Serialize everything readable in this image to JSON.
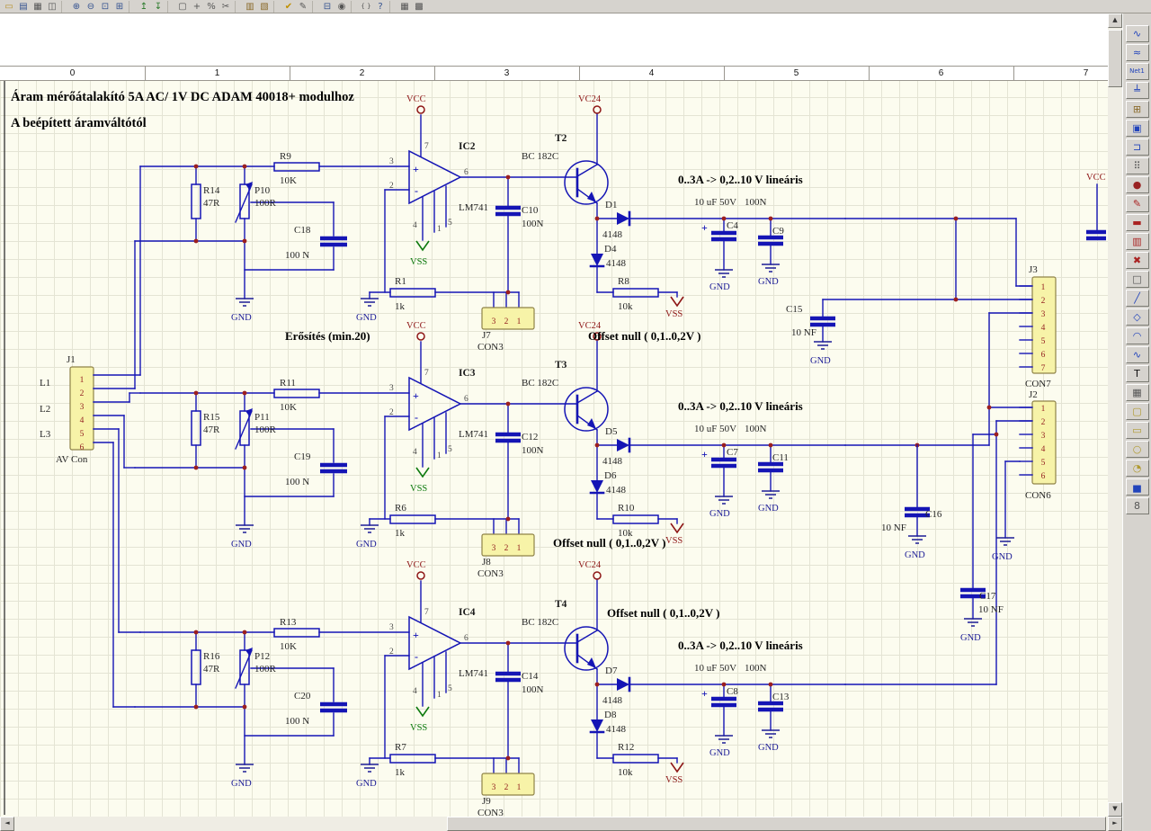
{
  "titles": {
    "line1": "Áram mérőátalakító 5A AC/ 1V DC ADAM 40018+ modulhoz",
    "line2": "A beépített áramváltótól"
  },
  "annotations": {
    "gain": "Erősítés (min.20)"
  },
  "nets": {
    "gnd": "GND",
    "vcc": "VCC",
    "vss": "VSS",
    "vc24": "VC24"
  },
  "pins": {
    "p1": "1",
    "p2": "2",
    "p3": "3",
    "p4": "4",
    "p5": "5",
    "p6": "6",
    "p7": "7"
  },
  "sym": {
    "plus": "+",
    "minus": "-"
  },
  "ruler": {
    "numbers": [
      "0",
      "1",
      "2",
      "3",
      "4",
      "5",
      "6",
      "7"
    ]
  },
  "channels": [
    {
      "opamp": {
        "ref": "IC2",
        "part": "LM741"
      },
      "r_series": {
        "ref": "R9",
        "val": "10K"
      },
      "r_in": {
        "ref": "R14",
        "val": "47R"
      },
      "pot": {
        "ref": "P10",
        "val": "100R"
      },
      "c_fb": {
        "ref": "C18",
        "val": "100 N"
      },
      "c_out": {
        "ref": "C10",
        "val": "100N"
      },
      "transistor": {
        "ref": "T2",
        "part": "BC 182C"
      },
      "d_series": {
        "ref": "D1",
        "val": "4148"
      },
      "d_shunt": {
        "ref": "D4",
        "val": "4148"
      },
      "r_fb": {
        "ref": "R1",
        "val": "1k"
      },
      "r_out": {
        "ref": "R8",
        "val": "10k"
      },
      "cap_el": {
        "ref": "C4",
        "val": "10 uF 50V"
      },
      "cap_cer": {
        "ref": "C9",
        "val": "100N"
      },
      "conn": {
        "ref": "J7",
        "type": "CON3",
        "pins": [
          "3",
          "2",
          "1"
        ]
      },
      "ann_linear": "0..3A -> 0,2..10 V lineáris",
      "ann_offset": "Offset null ( 0,1..0,2V )"
    },
    {
      "opamp": {
        "ref": "IC3",
        "part": "LM741"
      },
      "r_series": {
        "ref": "R11",
        "val": "10K"
      },
      "r_in": {
        "ref": "R15",
        "val": "47R"
      },
      "pot": {
        "ref": "P11",
        "val": "100R"
      },
      "c_fb": {
        "ref": "C19",
        "val": "100 N"
      },
      "c_out": {
        "ref": "C12",
        "val": "100N"
      },
      "transistor": {
        "ref": "T3",
        "part": "BC 182C"
      },
      "d_series": {
        "ref": "D5",
        "val": "4148"
      },
      "d_shunt": {
        "ref": "D6",
        "val": "4148"
      },
      "r_fb": {
        "ref": "R6",
        "val": "1k"
      },
      "r_out": {
        "ref": "R10",
        "val": "10k"
      },
      "cap_el": {
        "ref": "C7",
        "val": "10 uF 50V"
      },
      "cap_cer": {
        "ref": "C11",
        "val": "100N"
      },
      "conn": {
        "ref": "J8",
        "type": "CON3",
        "pins": [
          "3",
          "2",
          "1"
        ]
      },
      "ann_linear": "0..3A -> 0,2..10 V lineáris",
      "ann_offset": "Offset null ( 0,1..0,2V )"
    },
    {
      "opamp": {
        "ref": "IC4",
        "part": "LM741"
      },
      "r_series": {
        "ref": "R13",
        "val": "10K"
      },
      "r_in": {
        "ref": "R16",
        "val": "47R"
      },
      "pot": {
        "ref": "P12",
        "val": "100R"
      },
      "c_fb": {
        "ref": "C20",
        "val": "100 N"
      },
      "c_out": {
        "ref": "C14",
        "val": "100N"
      },
      "transistor": {
        "ref": "T4",
        "part": "BC 182C"
      },
      "d_series": {
        "ref": "D7",
        "val": "4148"
      },
      "d_shunt": {
        "ref": "D8",
        "val": "4148"
      },
      "r_fb": {
        "ref": "R7",
        "val": "1k"
      },
      "r_out": {
        "ref": "R12",
        "val": "10k"
      },
      "cap_el": {
        "ref": "C8",
        "val": "10 uF 50V"
      },
      "cap_cer": {
        "ref": "C13",
        "val": "100N"
      },
      "conn": {
        "ref": "J9",
        "type": "CON3",
        "pins": [
          "3",
          "2",
          "1"
        ]
      },
      "ann_linear": "0..3A -> 0,2..10 V lineáris",
      "ann_offset": "Offset null ( 0,1..0,2V )"
    }
  ],
  "j1": {
    "ref": "J1",
    "type": "AV Con",
    "pins": [
      "1",
      "2",
      "3",
      "4",
      "5",
      "6"
    ],
    "phases": [
      "L1",
      "L2",
      "L3"
    ]
  },
  "j3": {
    "ref": "J3",
    "type": "CON7",
    "pins": [
      "1",
      "2",
      "3",
      "4",
      "5",
      "6",
      "7"
    ]
  },
  "j2": {
    "ref": "J2",
    "type": "CON6",
    "pins": [
      "1",
      "2",
      "3",
      "4",
      "5",
      "6"
    ]
  },
  "filter_caps": [
    {
      "ref": "C15",
      "val": "10 NF"
    },
    {
      "ref": "C16",
      "val": "10 NF"
    },
    {
      "ref": "C17",
      "val": "10 NF"
    }
  ],
  "edge": {
    "vcc": "VCC"
  },
  "toolbar": {
    "icons": [
      {
        "name": "open",
        "glyph": "▭",
        "color": "#b8912a"
      },
      {
        "name": "save",
        "glyph": "▤",
        "color": "#33518f"
      },
      {
        "name": "print",
        "glyph": "▦",
        "color": "#555555"
      },
      {
        "name": "print-preview",
        "glyph": "◫",
        "color": "#555555"
      },
      {
        "name": "separator"
      },
      {
        "name": "zoom-in",
        "glyph": "⊕",
        "color": "#33518f"
      },
      {
        "name": "zoom-out",
        "glyph": "⊖",
        "color": "#33518f"
      },
      {
        "name": "zoom-window",
        "glyph": "⊡",
        "color": "#33518f"
      },
      {
        "name": "zoom-all",
        "glyph": "⊞",
        "color": "#33518f"
      },
      {
        "name": "separator"
      },
      {
        "name": "ascend-hierarchy",
        "glyph": "↥",
        "color": "#2a7a2a"
      },
      {
        "name": "descend-hierarchy",
        "glyph": "↧",
        "color": "#2a7a2a"
      },
      {
        "name": "separator"
      },
      {
        "name": "select-area",
        "glyph": "▢",
        "color": "#555555"
      },
      {
        "name": "move-selection",
        "glyph": "+",
        "color": "#555555"
      },
      {
        "name": "scale",
        "glyph": "%",
        "color": "#555555"
      },
      {
        "name": "cut",
        "glyph": "✂",
        "color": "#555555"
      },
      {
        "name": "separator"
      },
      {
        "name": "library",
        "glyph": "▥",
        "color": "#8a6a2a"
      },
      {
        "name": "browse-library",
        "glyph": "▧",
        "color": "#8a6a2a"
      },
      {
        "name": "separator"
      },
      {
        "name": "erc-check",
        "glyph": "✔",
        "color": "#c09000"
      },
      {
        "name": "edit-sheet",
        "glyph": "✎",
        "color": "#555555"
      },
      {
        "name": "separator"
      },
      {
        "name": "add-part",
        "glyph": "⊟",
        "color": "#33518f"
      },
      {
        "name": "visibility",
        "glyph": "◉",
        "color": "#555555"
      },
      {
        "name": "separator"
      },
      {
        "name": "braces",
        "glyph": "{ }",
        "color": "#555555",
        "small": true
      },
      {
        "name": "help",
        "glyph": "?",
        "color": "#33518f"
      },
      {
        "name": "separator"
      },
      {
        "name": "print-setup",
        "glyph": "▦",
        "color": "#555555"
      },
      {
        "name": "grid-toggle",
        "glyph": "▩",
        "color": "#555555"
      }
    ]
  },
  "palette": {
    "tools": [
      {
        "name": "wire-tool",
        "glyph": "∿",
        "color": "#2244bb"
      },
      {
        "name": "bus-tool",
        "glyph": "≈",
        "color": "#2244bb"
      },
      {
        "name": "net-label-tool",
        "glyph": "Net1",
        "color": "#2244bb",
        "small": true
      },
      {
        "name": "power-port-tool",
        "glyph": "╧",
        "color": "#2244bb"
      },
      {
        "name": "part-tool",
        "glyph": "⊞",
        "color": "#8a6a2a"
      },
      {
        "name": "sheet-symbol-tool",
        "glyph": "▣",
        "color": "#2244bb"
      },
      {
        "name": "sheet-entry-tool",
        "glyph": "⊐",
        "color": "#2244bb"
      },
      {
        "name": "array-tool",
        "glyph": "⠿",
        "color": "#555555"
      },
      {
        "name": "junction-tool",
        "glyph": "●",
        "color": "#992222"
      },
      {
        "name": "annotate-pen-tool",
        "glyph": "✎",
        "color": "#aa2222"
      },
      {
        "name": "brush-tool",
        "glyph": "▬",
        "color": "#aa2222"
      },
      {
        "name": "matrix-tool",
        "glyph": "▥",
        "color": "#aa2222"
      },
      {
        "name": "delete-tool",
        "glyph": "✖",
        "color": "#aa2222"
      },
      {
        "name": "new-sheet-tool",
        "glyph": "□",
        "color": "#555555"
      },
      {
        "name": "line-tool",
        "glyph": "╱",
        "color": "#2244bb"
      },
      {
        "name": "polygon-tool",
        "glyph": "◇",
        "color": "#2244bb"
      },
      {
        "name": "arc-tool",
        "glyph": "◠",
        "color": "#2244bb"
      },
      {
        "name": "bezier-tool",
        "glyph": "∿",
        "color": "#2244bb"
      },
      {
        "name": "text-tool",
        "glyph": "T",
        "color": "#111111"
      },
      {
        "name": "table-tool",
        "glyph": "▦",
        "color": "#555555"
      },
      {
        "name": "rounded-rect-tool",
        "glyph": "▢",
        "color": "#b09a30"
      },
      {
        "name": "rect-tool",
        "glyph": "▭",
        "color": "#b09a30"
      },
      {
        "name": "ellipse-tool",
        "glyph": "○",
        "color": "#b09a30"
      },
      {
        "name": "pie-tool",
        "glyph": "◔",
        "color": "#b09a30"
      },
      {
        "name": "chart-tool",
        "glyph": "▅",
        "color": "#2244bb"
      },
      {
        "name": "seven-seg-tool",
        "glyph": "8",
        "color": "#555555"
      }
    ]
  }
}
